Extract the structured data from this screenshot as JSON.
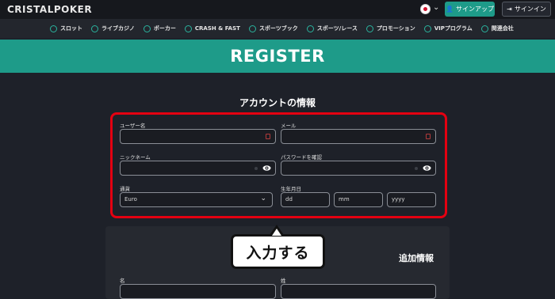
{
  "header": {
    "logo": "CRISTALPOKER",
    "signup_label": "サインアップ",
    "signin_label": "サインイン"
  },
  "nav": {
    "items": [
      {
        "label": "スロット",
        "icon": "slot-icon"
      },
      {
        "label": "ライブカジノ",
        "icon": "live-casino-icon"
      },
      {
        "label": "ポーカー",
        "icon": "poker-icon"
      },
      {
        "label": "CRASH & FAST",
        "icon": "rocket-icon"
      },
      {
        "label": "スポーツブック",
        "icon": "sportsbook-icon"
      },
      {
        "label": "スポーツ/レース",
        "icon": "race-icon"
      },
      {
        "label": "プロモーション",
        "icon": "promotion-icon"
      },
      {
        "label": "VIPプログラム",
        "icon": "vip-icon"
      },
      {
        "label": "関連会社",
        "icon": "affiliate-icon"
      }
    ]
  },
  "banner": {
    "title": "REGISTER"
  },
  "account_section": {
    "title": "アカウントの情報",
    "username_label": "ユーザー名",
    "email_label": "メール",
    "nickname_label": "ニックネーム",
    "password_confirm_label": "パスワードを確認",
    "currency_label": "通貨",
    "currency_value": "Euro",
    "birthdate_label": "生年月日",
    "dd_placeholder": "dd",
    "mm_placeholder": "mm",
    "yyyy_placeholder": "yyyy"
  },
  "additional_section": {
    "title": "追加情報",
    "first_name_label": "名",
    "last_name_label": "姓"
  },
  "callout": {
    "text": "入力する"
  },
  "colors": {
    "accent": "#1e9b89",
    "background": "#1e2129",
    "highlight": "#e40011"
  }
}
